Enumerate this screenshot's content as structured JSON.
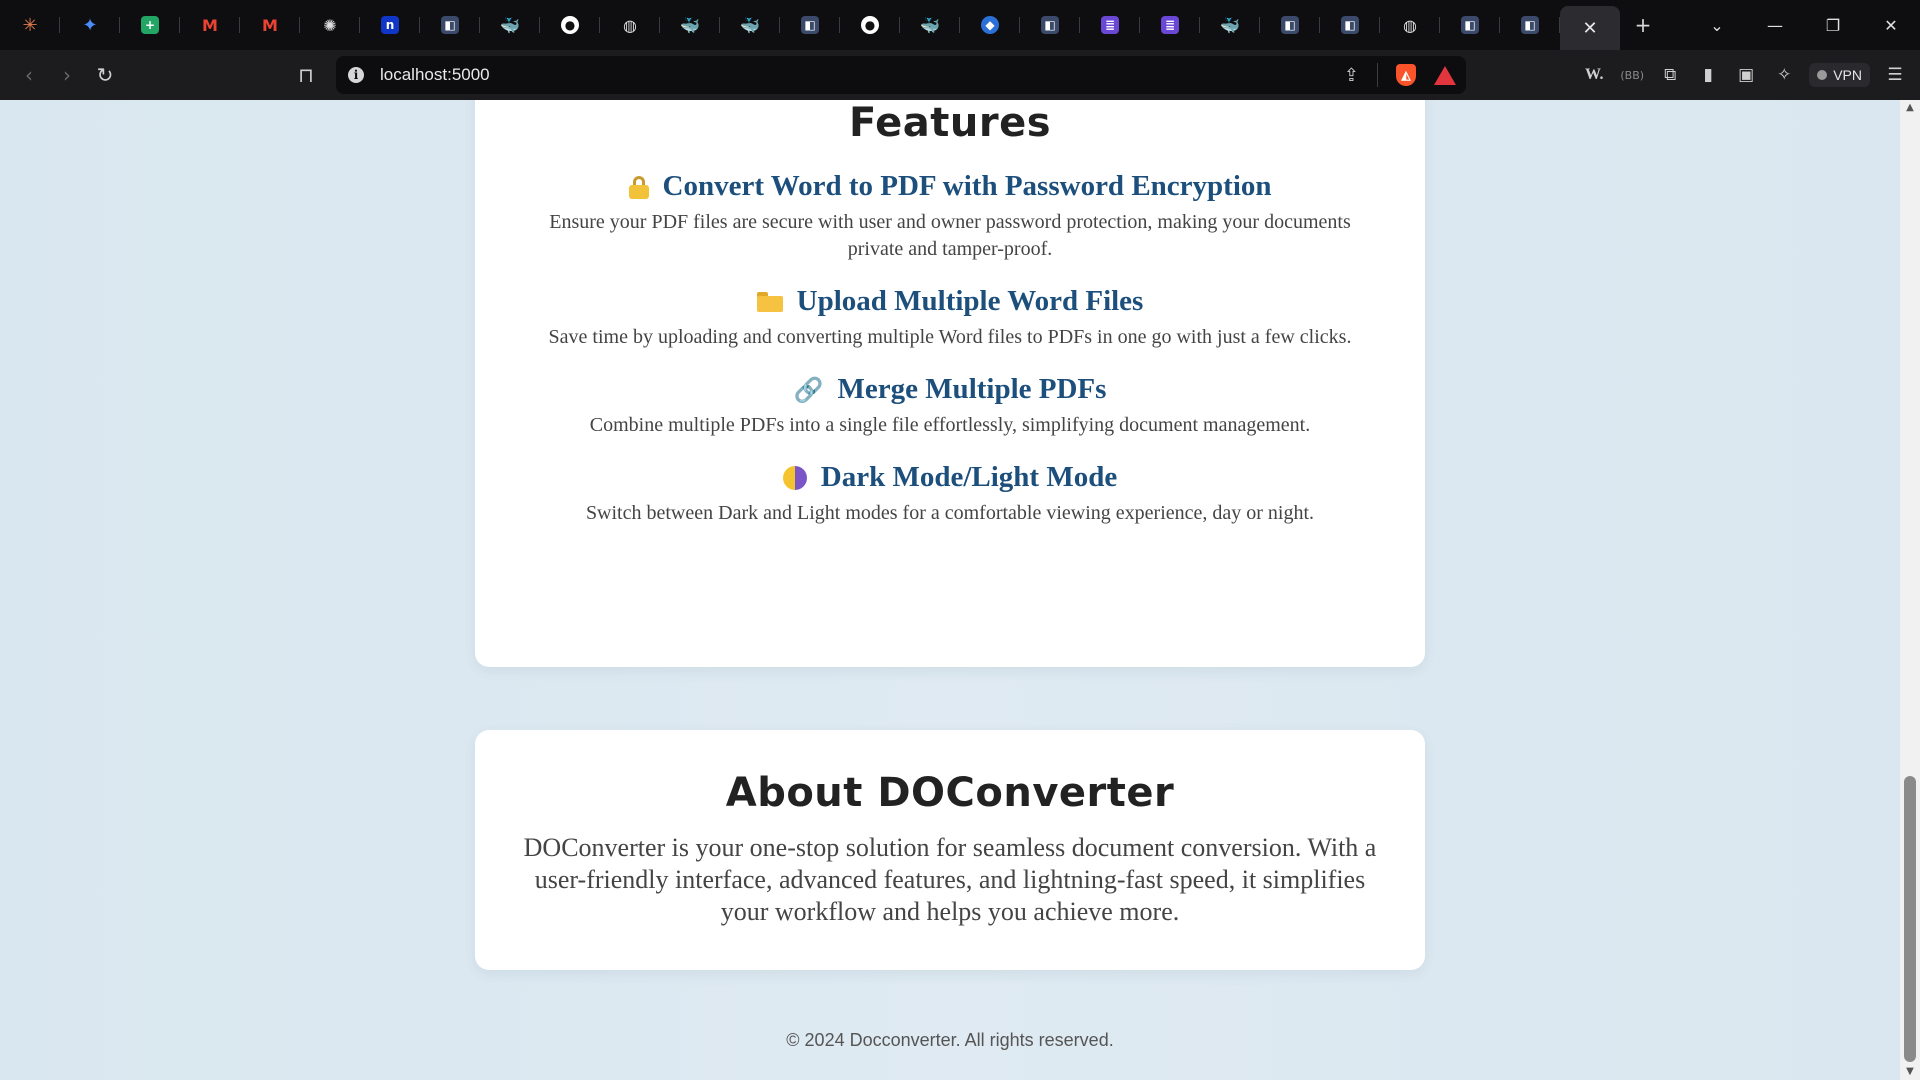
{
  "browser": {
    "tabs": [
      {
        "icon": "claude-icon",
        "glyph": "✳",
        "kind": "claude"
      },
      {
        "icon": "gemini-icon",
        "glyph": "✦",
        "kind": "gemini"
      },
      {
        "icon": "google-sheets-icon",
        "glyph": "+",
        "kind": "sheets"
      },
      {
        "icon": "gmail-icon",
        "glyph": "M",
        "kind": "gmail"
      },
      {
        "icon": "gmail-icon",
        "glyph": "M",
        "kind": "gmail"
      },
      {
        "icon": "openai-icon",
        "glyph": "✺",
        "kind": "openai"
      },
      {
        "icon": "notion-icon",
        "glyph": "n",
        "kind": "notion"
      },
      {
        "icon": "page-icon",
        "glyph": "◧",
        "kind": "gen"
      },
      {
        "icon": "docker-icon",
        "glyph": "🐳",
        "kind": "docker"
      },
      {
        "icon": "github-icon",
        "glyph": "●",
        "kind": "gh"
      },
      {
        "icon": "globe-icon",
        "glyph": "◍",
        "kind": "globe"
      },
      {
        "icon": "docker-icon",
        "glyph": "🐳",
        "kind": "docker"
      },
      {
        "icon": "docker-icon",
        "glyph": "🐳",
        "kind": "docker"
      },
      {
        "icon": "page-icon",
        "glyph": "◧",
        "kind": "gen"
      },
      {
        "icon": "github-icon",
        "glyph": "●",
        "kind": "gh"
      },
      {
        "icon": "docker-icon",
        "glyph": "🐳",
        "kind": "docker"
      },
      {
        "icon": "shield-icon",
        "glyph": "◆",
        "kind": "shield"
      },
      {
        "icon": "page-icon",
        "glyph": "◧",
        "kind": "gen"
      },
      {
        "icon": "list-icon",
        "glyph": "≣",
        "kind": "purple"
      },
      {
        "icon": "list-icon",
        "glyph": "≣",
        "kind": "purple"
      },
      {
        "icon": "docker-icon",
        "glyph": "🐳",
        "kind": "docker"
      },
      {
        "icon": "page-icon",
        "glyph": "◧",
        "kind": "gen"
      },
      {
        "icon": "page-icon",
        "glyph": "◧",
        "kind": "gen"
      },
      {
        "icon": "wave-icon",
        "glyph": "◍",
        "kind": "globe"
      },
      {
        "icon": "page-icon",
        "glyph": "◧",
        "kind": "gen"
      },
      {
        "icon": "page-icon",
        "glyph": "◧",
        "kind": "gen"
      }
    ],
    "active_tab_close": "✕",
    "new_tab": "+",
    "tab_list": "⌄",
    "minimize": "—",
    "restore": "❐",
    "close": "✕",
    "url": "localhost:5000",
    "vpn_label": "VPN",
    "ext_w": "W.",
    "ext_bb": "(BB)"
  },
  "features": {
    "heading": "Features",
    "items": [
      {
        "title": "Convert Word to PDF with Password Encryption",
        "desc": "Ensure your PDF files are secure with user and owner password protection, making your documents private and tamper-proof."
      },
      {
        "title": "Upload Multiple Word Files",
        "desc": "Save time by uploading and converting multiple Word files to PDFs in one go with just a few clicks."
      },
      {
        "title": "Merge Multiple PDFs",
        "desc": "Combine multiple PDFs into a single file effortlessly, simplifying document management."
      },
      {
        "title": "Dark Mode/Light Mode",
        "desc": "Switch between Dark and Light modes for a comfortable viewing experience, day or night."
      }
    ]
  },
  "about": {
    "heading": "About DOConverter",
    "text": "DOConverter is your one-stop solution for seamless document conversion. With a user-friendly interface, advanced features, and lightning-fast speed, it simplifies your workflow and helps you achieve more."
  },
  "footer": {
    "text": "© 2024 Docconverter. All rights reserved."
  },
  "colors": {
    "feature_title": "#1d4f7c",
    "page_bg": "#dde9f1",
    "card_bg": "#ffffff"
  }
}
